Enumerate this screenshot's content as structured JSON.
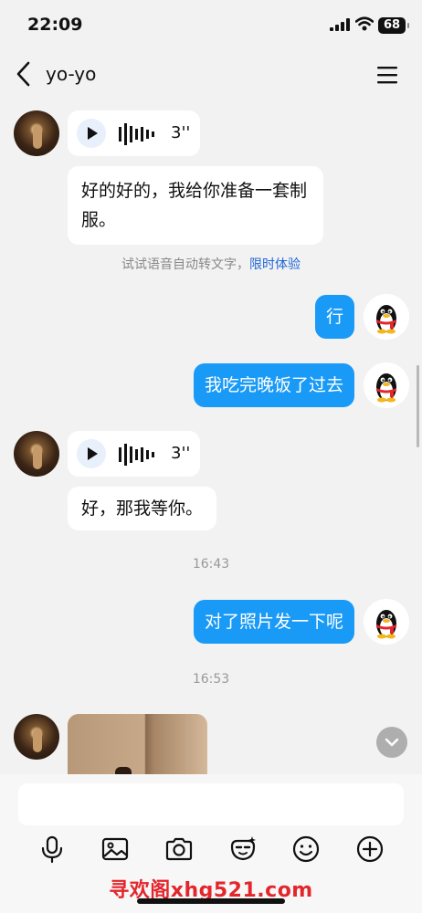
{
  "status": {
    "time": "22:09",
    "battery": "68"
  },
  "nav": {
    "title": "yo-yo"
  },
  "messages": [
    {
      "voice_duration": "3''"
    },
    {
      "text": "好的好的，我给你准备一套制服。"
    },
    {
      "text": "行"
    },
    {
      "text": "我吃完晚饭了过去"
    },
    {
      "voice_duration": "3''"
    },
    {
      "text": "好，那我等你。"
    },
    {
      "text": "对了照片发一下呢"
    }
  ],
  "tip": {
    "text": "试试语音自动转文字，",
    "link": "限时体验"
  },
  "time_separators": [
    "16:43",
    "16:53"
  ],
  "input": {
    "value": ""
  },
  "watermark": "寻欢阁xhg521.com",
  "icons": [
    "back-icon",
    "menu-icon",
    "play-icon",
    "voice-wave-icon",
    "mic-icon",
    "image-icon",
    "camera-icon",
    "sticker-icon",
    "emoji-icon",
    "plus-icon",
    "scroll-down-icon"
  ]
}
